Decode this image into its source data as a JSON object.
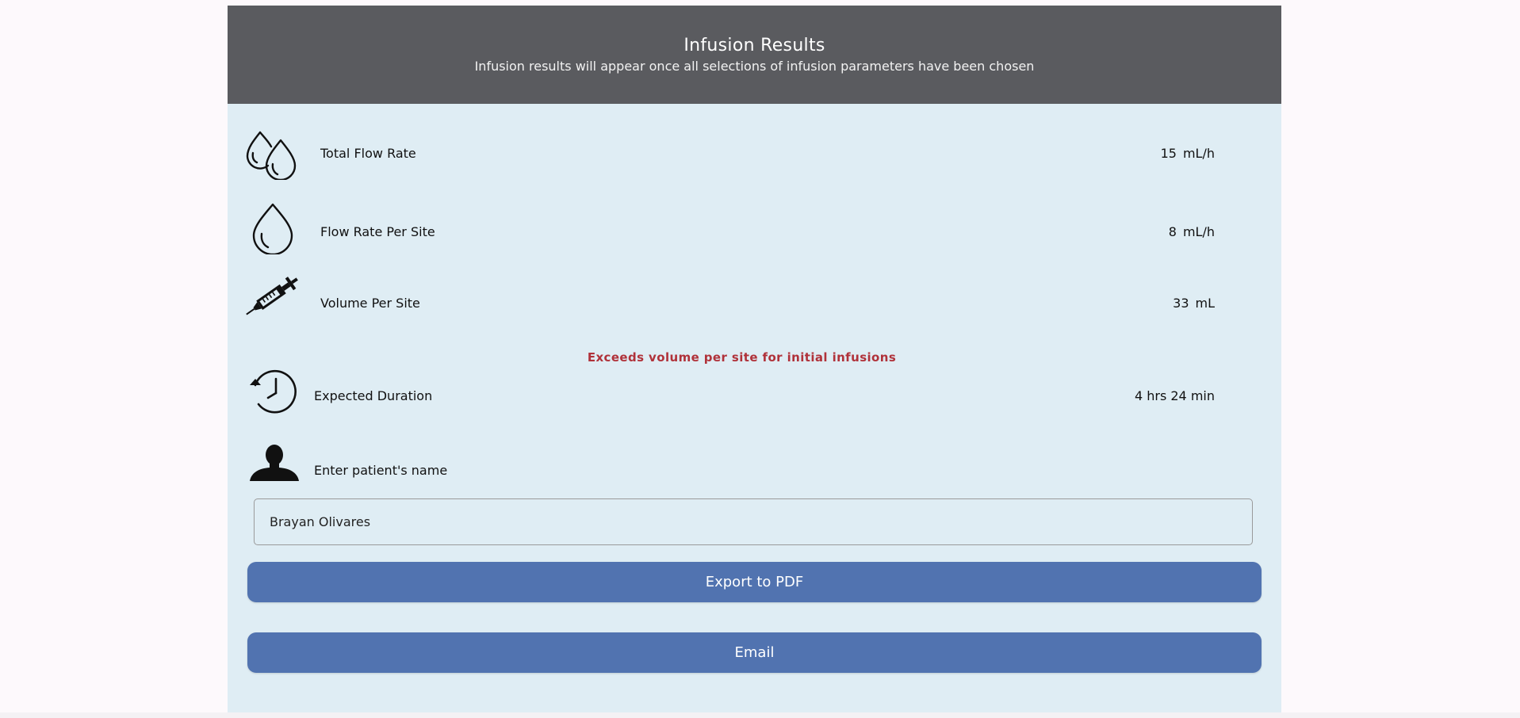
{
  "header": {
    "title": "Infusion Results",
    "subtitle": "Infusion results will appear once all selections of infusion parameters have been chosen"
  },
  "results": {
    "total_flow_rate": {
      "label": "Total Flow Rate",
      "value": "15",
      "unit": "mL/h",
      "icon": "double-droplet-icon"
    },
    "flow_rate_per_site": {
      "label": "Flow Rate Per Site",
      "value": "8",
      "unit": "mL/h",
      "icon": "droplet-icon"
    },
    "volume_per_site": {
      "label": "Volume Per Site",
      "value": "33",
      "unit": "mL",
      "icon": "syringe-icon"
    },
    "warning": "Exceeds volume per site for initial infusions",
    "expected_duration": {
      "label": "Expected Duration",
      "value": "4 hrs 24 min",
      "icon": "history-clock-icon"
    }
  },
  "patient": {
    "label": "Enter patient's name",
    "icon": "person-icon",
    "name_value": "Brayan Olivares"
  },
  "actions": {
    "export_label": "Export to PDF",
    "email_label": "Email"
  },
  "colors": {
    "header_bg": "#5a5b5f",
    "panel_bg": "#dfedf4",
    "button_bg": "#5173b0",
    "warning": "#b0323a"
  }
}
